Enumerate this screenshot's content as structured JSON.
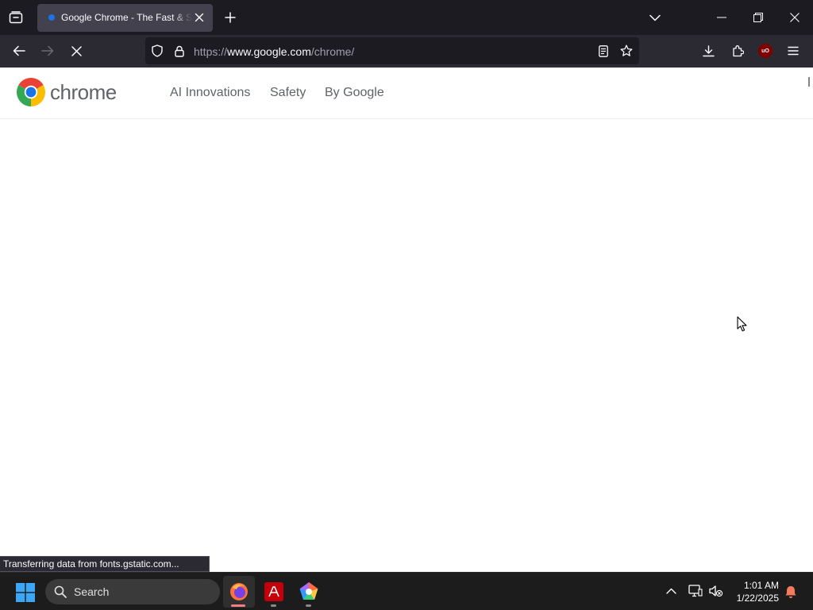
{
  "browser": {
    "tab": {
      "title": "Google Chrome - The Fast & Secure Web Browser Built to be Yours",
      "favicon": "loading-dot-icon",
      "close_icon": "close-icon"
    },
    "new_tab_icon": "plus-icon",
    "list_all_tabs_icon": "chevron-down-icon",
    "window_controls": [
      "minimize-icon",
      "restore-icon",
      "close-icon"
    ],
    "url": {
      "scheme": "https://",
      "host": "www.google.com",
      "path": "/chrome/"
    },
    "loading": true,
    "accent_ublock": "#800000",
    "ublock_label": "uO",
    "status_text": "Transferring data from fonts.gstatic.com..."
  },
  "site": {
    "brand": "chrome",
    "nav": [
      "AI Innovations",
      "Safety",
      "By Google"
    ]
  },
  "taskbar": {
    "search_placeholder": "Search",
    "apps": [
      "firefox-icon",
      "adobe-acrobat-icon",
      "photo-app-icon"
    ],
    "time": "1:01 AM",
    "date": "1/22/2025"
  },
  "colors": {
    "tabstrip": "#1c1b22",
    "navbar": "#2b2a33",
    "taskbar": "#1c1c1c",
    "brand_text": "#5f6368"
  }
}
